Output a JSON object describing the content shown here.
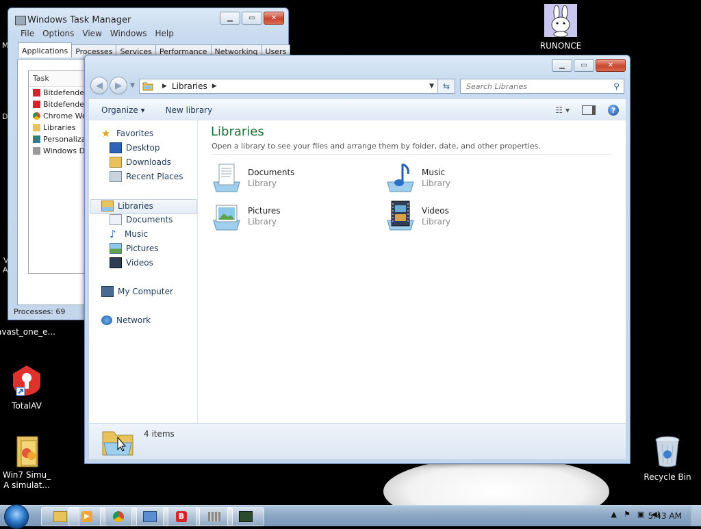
{
  "desktop": {
    "icons": [
      {
        "label": "RUNONCE"
      },
      {
        "label": "avast_one_e..."
      },
      {
        "label": "TotalAV"
      },
      {
        "label": "Win7 Simu_ A simulat..."
      },
      {
        "label": "Recycle Bin"
      }
    ],
    "edge_text": [
      "M",
      "D",
      "V",
      "A"
    ]
  },
  "task_manager": {
    "title": "Windows Task Manager",
    "menu": [
      "File",
      "Options",
      "View",
      "Windows",
      "Help"
    ],
    "tabs": [
      "Applications",
      "Processes",
      "Services",
      "Performance",
      "Networking",
      "Users"
    ],
    "active_tab": "Applications",
    "column": "Task",
    "tasks": [
      {
        "name": "Bitdefender",
        "icon": "bitdefender-icon"
      },
      {
        "name": "Bitdefender",
        "icon": "bitdefender-icon"
      },
      {
        "name": "Chrome Wel",
        "icon": "chrome-icon"
      },
      {
        "name": "Libraries",
        "icon": "libraries-folder-icon"
      },
      {
        "name": "Personalizat",
        "icon": "personalization-icon"
      },
      {
        "name": "Windows De",
        "icon": "windows-icon"
      }
    ],
    "status": "Processes: 69"
  },
  "explorer": {
    "address": {
      "crumb": "Libraries"
    },
    "search_placeholder": "Search Libraries",
    "toolbar": {
      "organize": "Organize",
      "new_library": "New library"
    },
    "nav": {
      "favorites": "Favorites",
      "favorites_items": [
        "Desktop",
        "Downloads",
        "Recent Places"
      ],
      "libraries": "Libraries",
      "libraries_items": [
        "Documents",
        "Music",
        "Pictures",
        "Videos"
      ],
      "computer": "My Computer",
      "network": "Network"
    },
    "content": {
      "heading": "Libraries",
      "subtitle": "Open a library to see your files and arrange them by folder, date, and other properties.",
      "items": [
        {
          "name": "Documents",
          "type": "Library"
        },
        {
          "name": "Music",
          "type": "Library"
        },
        {
          "name": "Pictures",
          "type": "Library"
        },
        {
          "name": "Videos",
          "type": "Library"
        }
      ]
    },
    "details": {
      "count": "4 items"
    }
  },
  "taskbar": {
    "clock": "5:43 AM",
    "pinned": [
      "explorer-icon",
      "media-player-icon",
      "chrome-icon",
      "remote-desktop-icon",
      "bitdefender-icon",
      "generic-app-icon",
      "task-manager-icon"
    ]
  }
}
